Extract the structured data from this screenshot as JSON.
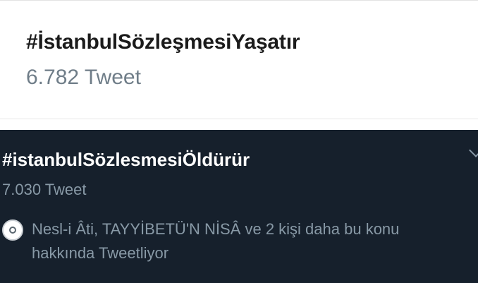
{
  "trend_light": {
    "hashtag": "#İstanbulSözleşmesiYaşatır",
    "count": "6.782 Tweet"
  },
  "trend_dark": {
    "hashtag": "#istanbulSözlesmesiÖldürür",
    "count": "7.030 Tweet",
    "social_line1": "Nesl-i Âti, TAYYİBETÜ'N  NİSÂ ve 2 kişi daha bu konu",
    "social_line2": "hakkında Tweetliyor"
  },
  "colors": {
    "light_bg": "#ffffff",
    "dark_bg": "#16202c",
    "muted_text": "#8899a6",
    "count_light": "#6f7d88"
  },
  "icons": {
    "avatar": "avatar-icon",
    "menu": "chevron-down-icon"
  }
}
